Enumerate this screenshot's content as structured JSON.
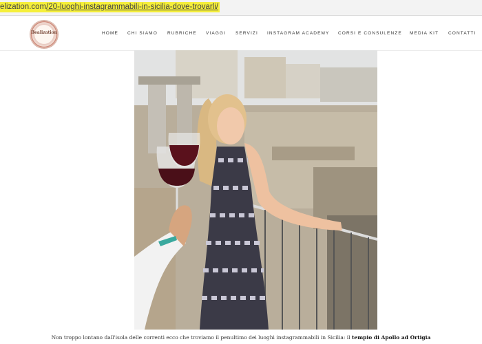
{
  "browser": {
    "url_domain": "elization.com",
    "url_path": "/20-luoghi-instagrammabili-in-sicilia-dove-trovarli/"
  },
  "site": {
    "logo_text": "Bealization",
    "nav": [
      "HOME",
      "CHI SIAMO",
      "RUBRICHE",
      "VIAGGI",
      "SERVIZI",
      "INSTAGRAM ACADEMY",
      "CORSI E CONSULENZE",
      "MEDIA KIT",
      "CONTATTI"
    ]
  },
  "article": {
    "photo_icon": "photo-woman-wine-temple-ruins",
    "caption_start": "Non troppo lontano dall'isola delle correnti ecco che troviamo il penultimo dei luoghi instagrammabili in Sicilia: il",
    "caption_bold": "tempio di Apollo ad Ortigia"
  }
}
